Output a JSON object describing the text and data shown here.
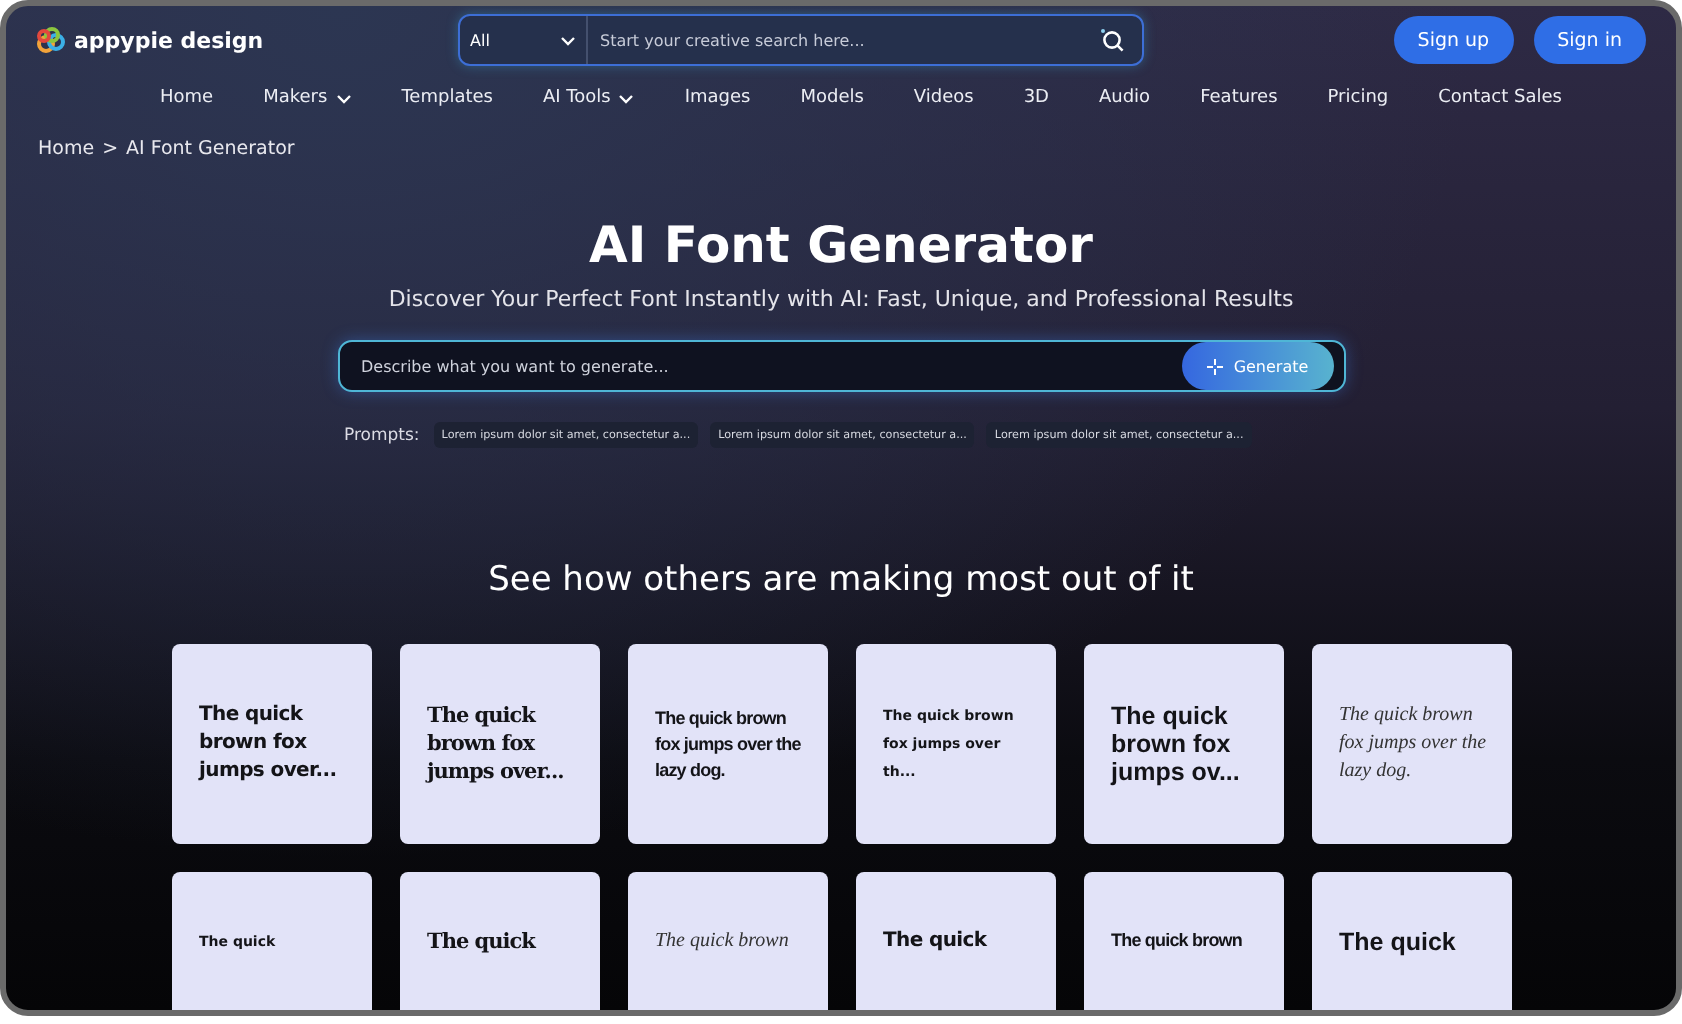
{
  "header": {
    "logo_text": "appypie design",
    "search": {
      "category": "All",
      "placeholder": "Start your creative search here..."
    },
    "buttons": [
      "Sign up",
      "Sign in"
    ]
  },
  "nav": [
    {
      "label": "Home",
      "has_menu": false
    },
    {
      "label": "Makers",
      "has_menu": true
    },
    {
      "label": "Templates",
      "has_menu": false
    },
    {
      "label": "AI Tools",
      "has_menu": true
    },
    {
      "label": "Images",
      "has_menu": false
    },
    {
      "label": "Models",
      "has_menu": false
    },
    {
      "label": "Videos",
      "has_menu": false
    },
    {
      "label": "3D",
      "has_menu": false
    },
    {
      "label": "Audio",
      "has_menu": false
    },
    {
      "label": "Features",
      "has_menu": false
    },
    {
      "label": "Pricing",
      "has_menu": false
    },
    {
      "label": "Contact Sales",
      "has_menu": false
    }
  ],
  "breadcrumb": [
    "Home",
    "AI Font Generator"
  ],
  "breadcrumb_separator": ">",
  "hero": {
    "title": "AI Font Generator",
    "subtitle": "Discover Your Perfect Font Instantly with AI: Fast, Unique, and Professional Results",
    "input": {
      "placeholder": "Describe what you want to generate..."
    },
    "button": "Generate",
    "prompts_label": "Prompts:",
    "prompts": [
      "Lorem ipsum dolor sit amet, consectetur a...",
      "Lorem ipsum dolor sit amet, consectetur a...",
      "Lorem ipsum dolor sit amet, consectetur a..."
    ]
  },
  "gallery": {
    "title": "See how others are making most out of it",
    "cards": [
      {
        "kind": "rounded",
        "text": "The quick brown fox jumps over..."
      },
      {
        "kind": "serif",
        "text": "The quick brown fox jumps over..."
      },
      {
        "kind": "condensed",
        "text": "The quick brown fox jumps over the lazy dog."
      },
      {
        "kind": "small",
        "text": "The quick brown fox jumps over th..."
      },
      {
        "kind": "grotesk",
        "text": "The quick brown fox jumps ov..."
      },
      {
        "kind": "script",
        "text": "The quick brown fox jumps over the lazy dog."
      },
      {
        "kind": "small",
        "text": "The quick"
      },
      {
        "kind": "serif",
        "text": "The quick"
      },
      {
        "kind": "script",
        "text": "The quick brown"
      },
      {
        "kind": "rounded",
        "text": "The quick"
      },
      {
        "kind": "condensed",
        "text": "The quick brown"
      },
      {
        "kind": "grotesk",
        "text": "The quick"
      }
    ]
  }
}
